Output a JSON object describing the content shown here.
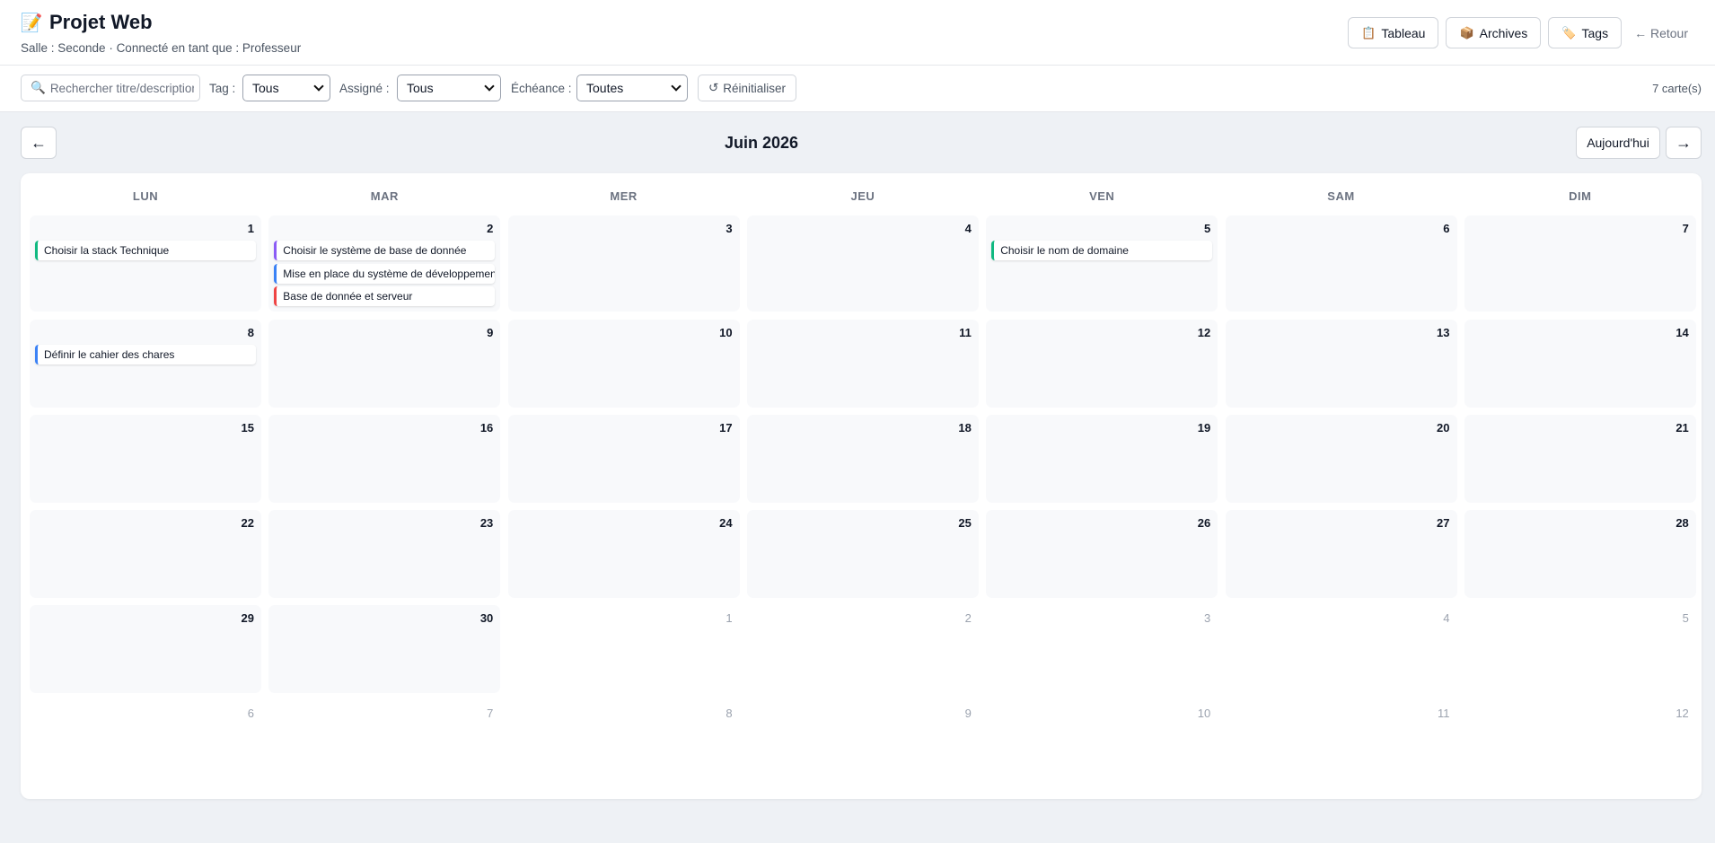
{
  "header": {
    "title_emoji": "📝",
    "title": "Projet Web",
    "subtitle": "Salle : Seconde · Connecté en tant que : Professeur",
    "buttons": [
      {
        "icon": "📋",
        "label": "Tableau"
      },
      {
        "icon": "📦",
        "label": "Archives"
      },
      {
        "icon": "🏷️",
        "label": "Tags"
      }
    ],
    "back_label": "← Retour"
  },
  "filters": {
    "search_placeholder": "Rechercher titre/description",
    "search_icon": "🔍",
    "tag_label": "Tag :",
    "tag_value": "Tous",
    "assigned_label": "Assigné :",
    "assigned_value": "Tous",
    "due_label": "Échéance :",
    "due_value": "Toutes",
    "reset_icon": "↺",
    "reset_label": "Réinitialiser",
    "count": "7 carte(s)"
  },
  "nav": {
    "prev": "←",
    "next": "→",
    "month": "Juin 2026",
    "today": "Aujourd'hui"
  },
  "weekdays": [
    "LUN",
    "MAR",
    "MER",
    "JEU",
    "VEN",
    "SAM",
    "DIM"
  ],
  "weeks": [
    [
      {
        "num": "1",
        "in": true,
        "cards": [
          {
            "title": "Choisir la stack Technique",
            "color": "#10b981"
          }
        ]
      },
      {
        "num": "2",
        "in": true,
        "cards": [
          {
            "title": "Choisir le système de base de donnée",
            "color": "#8b5cf6"
          },
          {
            "title": "Mise en place du système de développement",
            "color": "#3b82f6"
          },
          {
            "title": "Base de donnée et serveur",
            "color": "#ef4444"
          }
        ]
      },
      {
        "num": "3",
        "in": true,
        "cards": []
      },
      {
        "num": "4",
        "in": true,
        "cards": []
      },
      {
        "num": "5",
        "in": true,
        "cards": [
          {
            "title": "Choisir le nom de domaine",
            "color": "#10b981"
          }
        ]
      },
      {
        "num": "6",
        "in": true,
        "cards": []
      },
      {
        "num": "7",
        "in": true,
        "cards": []
      }
    ],
    [
      {
        "num": "8",
        "in": true,
        "cards": [
          {
            "title": "Définir le cahier des chares",
            "color": "#3b82f6"
          }
        ]
      },
      {
        "num": "9",
        "in": true,
        "cards": []
      },
      {
        "num": "10",
        "in": true,
        "cards": []
      },
      {
        "num": "11",
        "in": true,
        "cards": []
      },
      {
        "num": "12",
        "in": true,
        "cards": []
      },
      {
        "num": "13",
        "in": true,
        "cards": []
      },
      {
        "num": "14",
        "in": true,
        "cards": []
      }
    ],
    [
      {
        "num": "15",
        "in": true,
        "cards": []
      },
      {
        "num": "16",
        "in": true,
        "cards": []
      },
      {
        "num": "17",
        "in": true,
        "cards": []
      },
      {
        "num": "18",
        "in": true,
        "cards": []
      },
      {
        "num": "19",
        "in": true,
        "cards": []
      },
      {
        "num": "20",
        "in": true,
        "cards": []
      },
      {
        "num": "21",
        "in": true,
        "cards": []
      }
    ],
    [
      {
        "num": "22",
        "in": true,
        "cards": []
      },
      {
        "num": "23",
        "in": true,
        "cards": []
      },
      {
        "num": "24",
        "in": true,
        "cards": []
      },
      {
        "num": "25",
        "in": true,
        "cards": []
      },
      {
        "num": "26",
        "in": true,
        "cards": []
      },
      {
        "num": "27",
        "in": true,
        "cards": []
      },
      {
        "num": "28",
        "in": true,
        "cards": []
      }
    ],
    [
      {
        "num": "29",
        "in": true,
        "cards": []
      },
      {
        "num": "30",
        "in": true,
        "cards": []
      },
      {
        "num": "1",
        "in": false,
        "cards": []
      },
      {
        "num": "2",
        "in": false,
        "cards": []
      },
      {
        "num": "3",
        "in": false,
        "cards": []
      },
      {
        "num": "4",
        "in": false,
        "cards": []
      },
      {
        "num": "5",
        "in": false,
        "cards": []
      }
    ],
    [
      {
        "num": "6",
        "in": false,
        "cards": []
      },
      {
        "num": "7",
        "in": false,
        "cards": []
      },
      {
        "num": "8",
        "in": false,
        "cards": []
      },
      {
        "num": "9",
        "in": false,
        "cards": []
      },
      {
        "num": "10",
        "in": false,
        "cards": []
      },
      {
        "num": "11",
        "in": false,
        "cards": []
      },
      {
        "num": "12",
        "in": false,
        "cards": []
      }
    ]
  ]
}
